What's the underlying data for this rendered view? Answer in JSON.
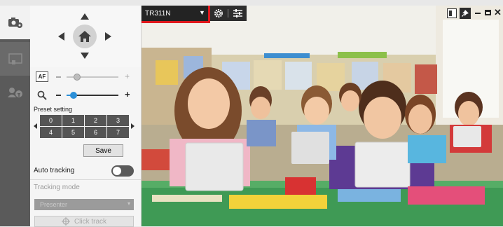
{
  "toolbar": {
    "device_name": "TR311N"
  },
  "ptz": {
    "focus_mode_label": "AF"
  },
  "preset": {
    "title": "Preset setting",
    "slots": [
      "0",
      "1",
      "2",
      "3",
      "4",
      "5",
      "6",
      "7"
    ],
    "save_label": "Save"
  },
  "tracking": {
    "auto_label": "Auto tracking",
    "auto_enabled": false,
    "mode_label": "Tracking mode",
    "mode_value": "Presenter",
    "click_track_label": "Click track"
  },
  "zoom": {
    "focus_level": 0.3,
    "zoom_level": 0.25
  },
  "colors": {
    "accent": "#2b8fd8",
    "highlight": "#e0181c"
  },
  "icons": [
    "camera-settings-icon",
    "preset-screen-icon",
    "voice-tracking-icon",
    "home-icon",
    "af-icon",
    "magnifier-icon",
    "gear-icon",
    "adjust-icon",
    "layout-icon",
    "pin-icon",
    "minimize-icon",
    "maximize-icon",
    "close-icon",
    "target-icon"
  ]
}
